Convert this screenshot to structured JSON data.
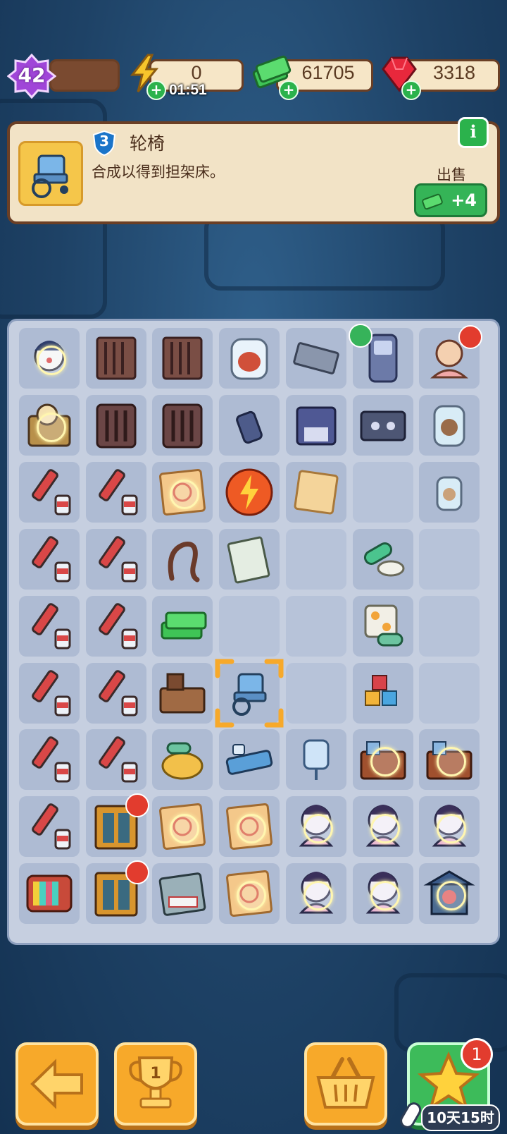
{
  "hud": {
    "level": "42",
    "energy": "0",
    "energy_timer": "01:51",
    "cash": "61705",
    "gems": "3318"
  },
  "info": {
    "item_level": "3",
    "item_name": "轮椅",
    "item_desc": "合成以得到担架床。",
    "sell_label": "出售",
    "sell_value": "+4",
    "info_icon": "i"
  },
  "board": {
    "rows": 9,
    "cols": 7,
    "items": [
      [
        "doll-clown",
        "cage",
        "cage",
        "jar-heart",
        "film-strip",
        "walkie-talkie",
        "doll-girl"
      ],
      [
        "box-toys",
        "cage-door",
        "cage-door",
        "usb-drive",
        "floppy-disk",
        "cassette",
        "jar-brain"
      ],
      [
        "syringe",
        "syringe",
        "map-treasure",
        "energy-orb",
        "old-paper",
        "",
        "jar-small"
      ],
      [
        "syringe",
        "syringe",
        "whip",
        "newspaper",
        "",
        "pills",
        ""
      ],
      [
        "syringe",
        "syringe",
        "cash-stack",
        "",
        "",
        "pill-pack",
        ""
      ],
      [
        "syringe",
        "syringe",
        "broken-desk",
        "wheelchair",
        "",
        "toy-blocks",
        ""
      ],
      [
        "syringe",
        "syringe",
        "pill-pile",
        "hospital-bed",
        "iv-bag",
        "desk-locked",
        "desk-locked"
      ],
      [
        "syringe",
        "elevator",
        "map-treasure",
        "map-treasure",
        "ghost-doll",
        "ghost-doll",
        "ghost-doll"
      ],
      [
        "tv-set",
        "elevator",
        "folder-deny",
        "map-treasure",
        "ghost-doll",
        "ghost-doll",
        "shrine"
      ]
    ]
  },
  "bottom": {
    "trophy_rank": "1",
    "notif_count": "1",
    "countdown": "10天15时"
  },
  "colors": {
    "accent_green": "#35b457",
    "panel_cream": "#f2e3c6",
    "button_orange": "#f7a92a",
    "selection": "#f7a92a"
  }
}
